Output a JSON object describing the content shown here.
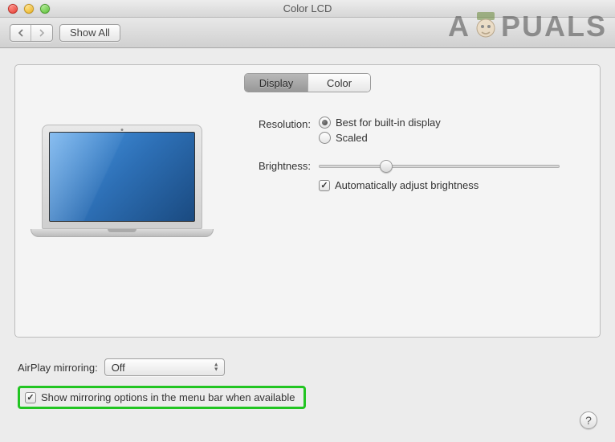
{
  "window": {
    "title": "Color LCD"
  },
  "toolbar": {
    "show_all": "Show All"
  },
  "watermark": {
    "left": "A",
    "right": "PUALS"
  },
  "tabs": {
    "display": "Display",
    "color": "Color"
  },
  "settings": {
    "resolution_label": "Resolution:",
    "resolution_best": "Best for built-in display",
    "resolution_scaled": "Scaled",
    "brightness_label": "Brightness:",
    "auto_brightness": "Automatically adjust brightness"
  },
  "airplay": {
    "label": "AirPlay mirroring:",
    "value": "Off"
  },
  "mirroring_checkbox": "Show mirroring options in the menu bar when available",
  "help": "?"
}
